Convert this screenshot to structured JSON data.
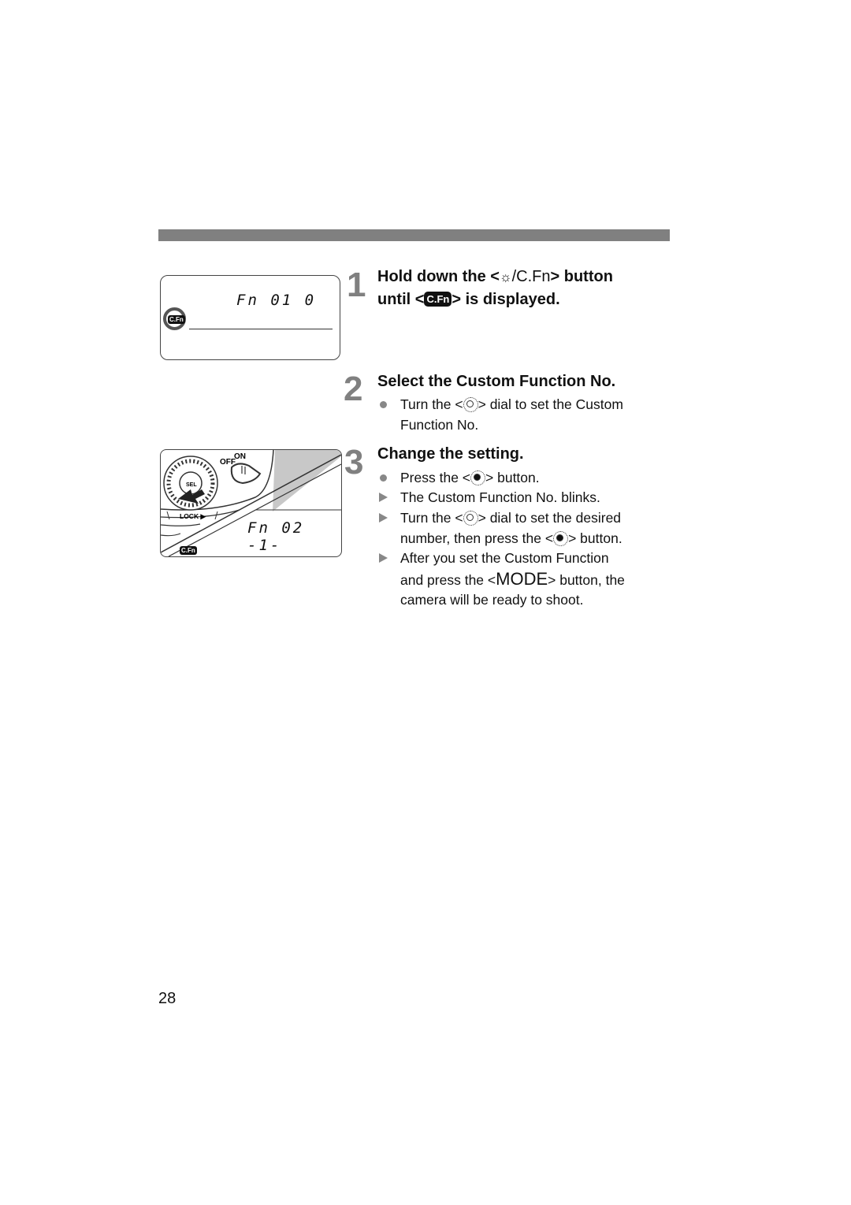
{
  "page": {
    "page_number": "28"
  },
  "illustrations": {
    "lcd1": {
      "display_text": "Fn 01 0",
      "badge": "C.Fn"
    },
    "camera": {
      "power_switch_off": "OFF",
      "power_switch_on": "ON",
      "sel_button": "SEL",
      "lock_label": "LOCK ▶",
      "display_text": "Fn 02 -1-",
      "badge": "C.Fn"
    }
  },
  "steps": [
    {
      "number": "1",
      "title_parts": {
        "a": "Hold down the <",
        "icon": "☼",
        "b": "/C.Fn",
        "c": "> button",
        "d": "until <",
        "badge": "C.Fn",
        "e": "> is displayed."
      }
    },
    {
      "number": "2",
      "title": "Select the Custom Function No.",
      "items": [
        {
          "bullet": "dot",
          "a": "Turn the <",
          "icon": "main-dial-icon",
          "b": "> dial to set the Custom",
          "c": "Function No."
        }
      ]
    },
    {
      "number": "3",
      "title": "Change the setting.",
      "items": [
        {
          "bullet": "dot",
          "a": "Press the <",
          "icon": "set-button-icon",
          "b": "> button."
        },
        {
          "bullet": "triangle",
          "a": "The Custom Function No. blinks."
        },
        {
          "bullet": "triangle",
          "a": "Turn the <",
          "icon": "main-dial-icon",
          "b": "> dial to set the desired",
          "c": "number, then press the <",
          "icon2": "set-button-icon",
          "d": "> button."
        },
        {
          "bullet": "triangle",
          "a": "After you set the Custom Function",
          "b": "and press the <",
          "mode": "MODE",
          "c": "> button, the",
          "d": "camera will be ready to shoot."
        }
      ]
    }
  ]
}
